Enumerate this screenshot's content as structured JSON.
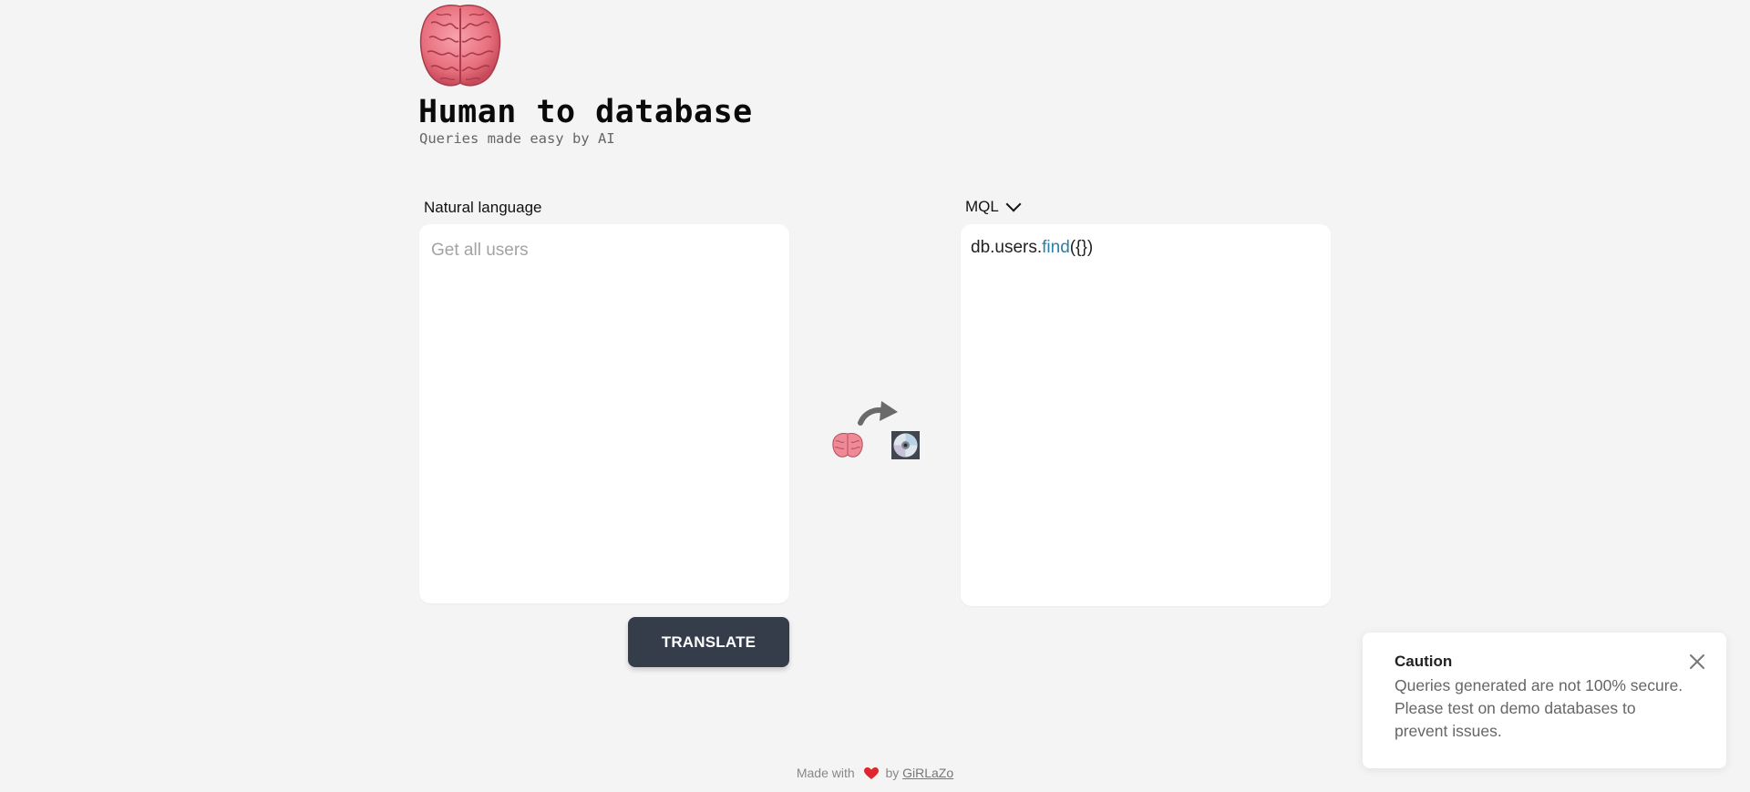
{
  "header": {
    "title": "Human to database",
    "subtitle": "Queries made easy by AI",
    "logo_icon": "brain-icon"
  },
  "input_panel": {
    "label": "Natural language",
    "placeholder": "Get all users",
    "value": ""
  },
  "output_panel": {
    "language": "MQL",
    "query_prefix": "db.users.",
    "query_function": "find",
    "query_args": "({})"
  },
  "translate_button": {
    "label": "TRANSLATE"
  },
  "flow_icons": [
    "brain-icon",
    "curved-arrow-icon",
    "disk-icon"
  ],
  "toast": {
    "title": "Caution",
    "message": "Queries generated are not 100% secure. Please test on demo databases to prevent issues."
  },
  "footer": {
    "made_with": "Made with",
    "by": "by",
    "author": "GiRLaZo"
  },
  "colors": {
    "background": "#f4f4f4",
    "button": "#353d4b",
    "function_name": "#2b7fa5",
    "heart": "#e0252c"
  }
}
